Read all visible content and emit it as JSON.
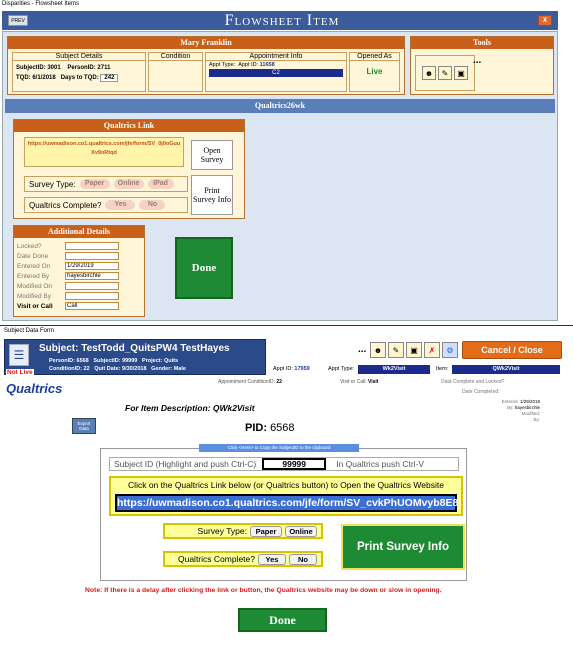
{
  "top_window": {
    "title": "Disparities - Flowsheet Items",
    "prev_label": "PREV",
    "header": "Flowsheet Item",
    "close_label": "X",
    "patient_name": "Mary Franklin",
    "subject_details": {
      "heading": "Subject Details",
      "subject_id_label": "SubjectID:",
      "subject_id": "3001",
      "person_id_label": "PersonID:",
      "person_id": "2711",
      "tqd_label": "TQD:",
      "tqd": "6/1/2018",
      "days_label": "Days to TQD:",
      "days": "242"
    },
    "condition_heading": "Condition",
    "appointment": {
      "heading": "Appointment Info",
      "appt_type_label": "Appt Type:",
      "appt_id_label": "Appt ID:",
      "appt_id": "11658",
      "code": "C2"
    },
    "opened_as": {
      "heading": "Opened As",
      "value": "Live"
    },
    "tools": {
      "heading": "Tools",
      "more": "..."
    },
    "section_title": "Qualtrics26wk",
    "qualtrics_link": {
      "heading": "Qualtrics Link",
      "url": "https://uwmadison.co1.qualtrics.com/jfe/form/SV_0j0oGuuXv9nRtqd",
      "open_survey": "Open Survey",
      "print_survey": "Print Survey Info",
      "survey_type_label": "Survey Type:",
      "types": [
        "Paper",
        "Online",
        "IPad"
      ],
      "complete_label": "Qualtrics Complete?",
      "yes": "Yes",
      "no": "No"
    },
    "additional": {
      "heading": "Additional Details",
      "rows": [
        {
          "label": "Locked?",
          "value": ""
        },
        {
          "label": "Date Done",
          "value": ""
        },
        {
          "label": "Entered On",
          "value": "1/29/2019"
        },
        {
          "label": "Entered By",
          "value": "hayesbirchle"
        },
        {
          "label": "Modified On",
          "value": ""
        },
        {
          "label": "Modified By",
          "value": ""
        },
        {
          "label": "Visit or Call",
          "value": "Call"
        }
      ]
    },
    "done": "Done"
  },
  "bottom_window": {
    "title": "Subject Data Form",
    "subject_label": "Subject:",
    "subject_name": "TestTodd_QuitsPW4 TestHayes",
    "person_id": "PersonID: 6568",
    "subject_id": "SubjectID: 99999",
    "project": "Project: Quits",
    "condition_id": "ConditionID: 22",
    "quit_date": "Quit Date: 9/30/2018",
    "gender": "Gender: Male",
    "not_live": "Not Live",
    "more": "...",
    "cancel_close": "Cancel / Close",
    "appt_id_label": "Appt ID:",
    "appt_id": "17959",
    "appt_type_label": "Appt Type:",
    "appt_type": "Wk2Visit",
    "item_label": "Item:",
    "item": "QWk2Visit",
    "appt_condition_label": "Appointment ConditionID:",
    "appt_condition": "22",
    "visit_call_label": "Visit or Call:",
    "visit_call": "Visit",
    "data_complete_label": "Data Complete and Locked?",
    "date_completed_label": "Date Completed:",
    "entered_label": "Entered:",
    "entered": "1/29/2019",
    "by_label": "By:",
    "by": "hayesbirchle",
    "modified_label": "Modified:",
    "by2_label": "By:",
    "qualtrics_heading": "Qualtrics",
    "item_description": "For Item Description: QWk2Visit",
    "export_data": "Export Data",
    "pid_label": "PID:",
    "pid": "6568",
    "copy_hint": "Click <Here> to Copy the SubjectID to the clipboard",
    "subject_id_hint": "Subject ID (Highlight and push Ctrl-C)",
    "subject_id_value": "99999",
    "in_qualtrics_hint": "In Qualtrics push Ctrl-V",
    "click_link_text": "Click on the Qualtrics Link below (or Qualtrics button) to Open the Qualtrics Website",
    "link_url": "https://uwmadison.co1.qualtrics.com/jfe/form/SV_cvkPhUOMvyb8E8I",
    "survey_type_label": "Survey Type:",
    "paper": "Paper",
    "online": "Online",
    "complete_label": "Qualtrics Complete?",
    "yes": "Yes",
    "no": "No",
    "print_survey_info": "Print Survey Info",
    "note": "Note: If there is a delay after clicking the link or button, the Qualtrics website may be down or slow in opening.",
    "done": "Done"
  },
  "colors": {
    "navy": "#3b5b9a",
    "orange": "#c8601a",
    "green": "#1f8a34",
    "cream": "#fff6d9"
  }
}
